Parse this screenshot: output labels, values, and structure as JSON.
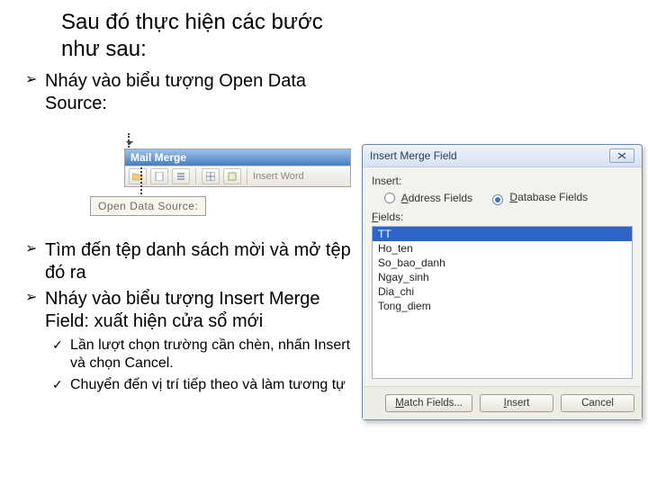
{
  "title": "Sau đó thực hiện các bước như sau:",
  "bullets_top": [
    "Nháy vào biểu tượng Open Data Source:"
  ],
  "bullets_mid": [
    "Tìm đến tệp danh sách mời và mở tệp đó ra",
    "Nháy vào biểu tượng Insert Merge Field: xuất hiện cửa sổ mới"
  ],
  "checks": [
    "Lần lượt chọn trường cần chèn, nhấn Insert và chọn Cancel.",
    "Chuyển đến vị trí tiếp theo và làm tương tự"
  ],
  "toolbar": {
    "title": "Mail Merge",
    "insert_word": "Insert Word",
    "tooltip": "Open Data Source:"
  },
  "dialog": {
    "title": "Insert Merge Field",
    "insert_label": "Insert:",
    "radio_address": "ddress Fields",
    "radio_address_accel": "A",
    "radio_db": "atabase Fields",
    "radio_db_accel": "D",
    "fields_label": "ields:",
    "fields_accel": "F",
    "fields": [
      "TT",
      "Ho_ten",
      "So_bao_danh",
      "Ngay_sinh",
      "Dia_chi",
      "Tong_diem"
    ],
    "btn_match": "atch Fields...",
    "btn_match_accel": "M",
    "btn_insert": "nsert",
    "btn_insert_accel": "I",
    "btn_cancel": "Cancel"
  }
}
